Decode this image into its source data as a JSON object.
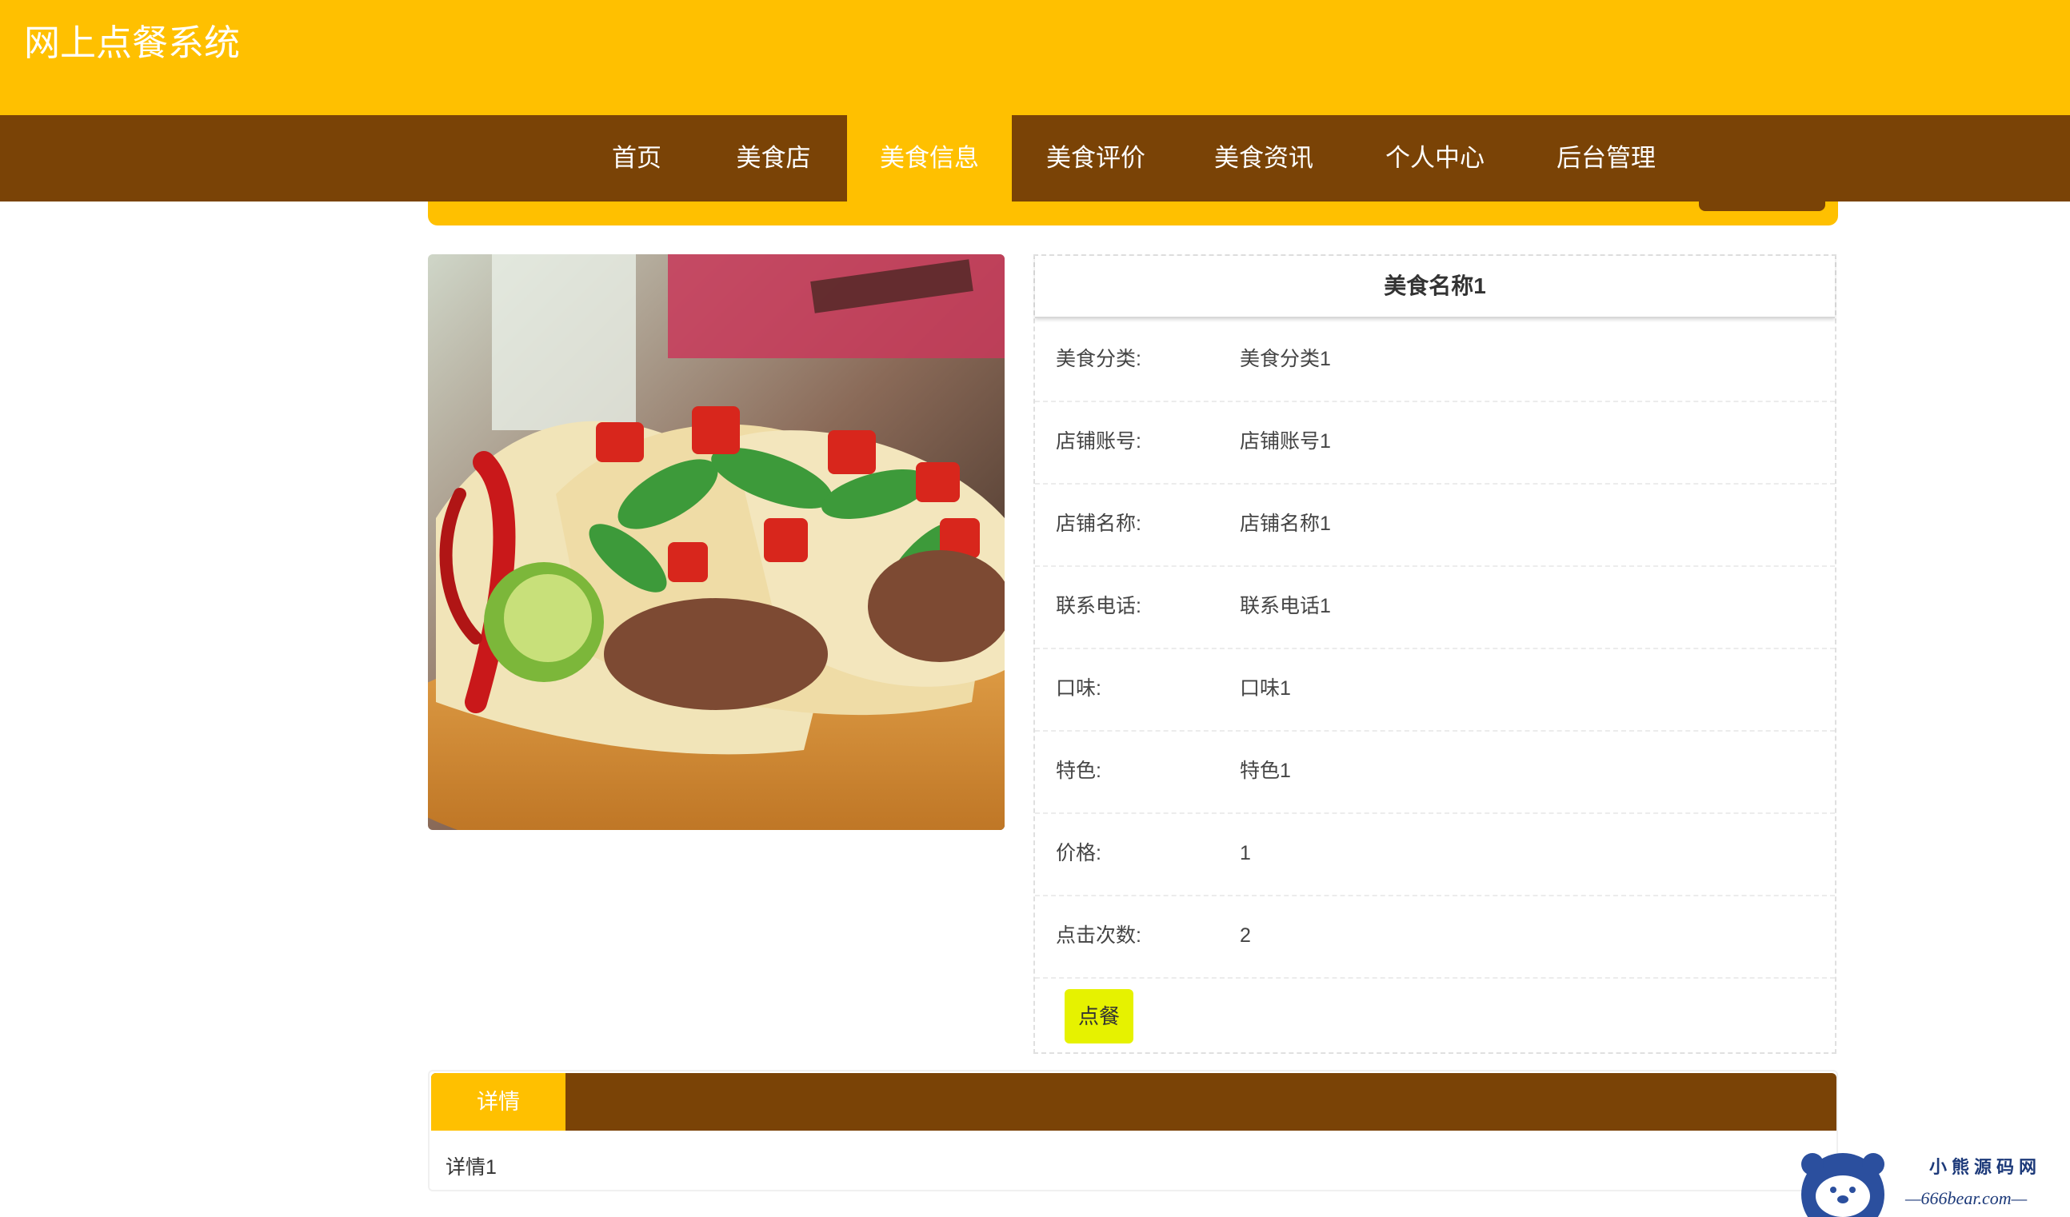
{
  "site": {
    "title": "网上点餐系统"
  },
  "nav": {
    "items": [
      {
        "label": "首页"
      },
      {
        "label": "美食店"
      },
      {
        "label": "美食信息",
        "active": true
      },
      {
        "label": "美食评价"
      },
      {
        "label": "美食资讯"
      },
      {
        "label": "个人中心"
      },
      {
        "label": "后台管理"
      }
    ]
  },
  "food": {
    "name": "美食名称1",
    "fields": [
      {
        "label": "美食分类:",
        "value": "美食分类1"
      },
      {
        "label": "店铺账号:",
        "value": "店铺账号1"
      },
      {
        "label": "店铺名称:",
        "value": "店铺名称1"
      },
      {
        "label": "联系电话:",
        "value": "联系电话1"
      },
      {
        "label": "口味:",
        "value": "口味1"
      },
      {
        "label": "特色:",
        "value": "特色1"
      },
      {
        "label": "价格:",
        "value": "1"
      },
      {
        "label": "点击次数:",
        "value": "2"
      }
    ],
    "order_label": "点餐"
  },
  "detail": {
    "tab_label": "详情",
    "content": "详情1"
  },
  "watermark": {
    "line1": "小熊源码网",
    "line2": "—666bear.com—"
  },
  "colors": {
    "primary": "#FFC000",
    "nav_bg": "#7A4306",
    "order_button": "#E6F200"
  }
}
